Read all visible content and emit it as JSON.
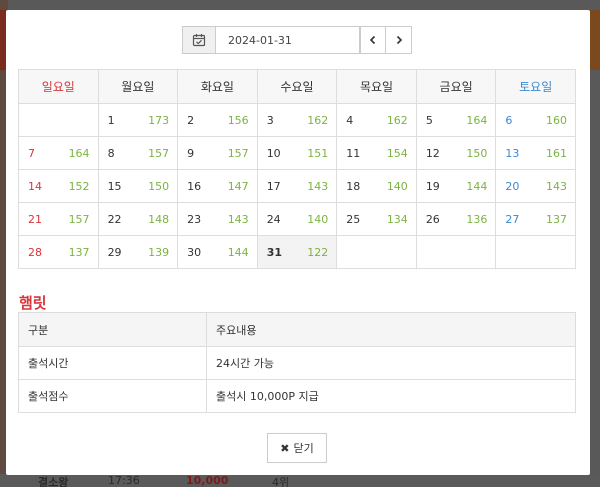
{
  "datebar": {
    "date_value": "2024-01-31",
    "prev_label": "‹",
    "next_label": "›"
  },
  "calendar": {
    "weekdays": [
      "일요일",
      "월요일",
      "화요일",
      "수요일",
      "목요일",
      "금요일",
      "토요일"
    ],
    "weeks": [
      [
        null,
        {
          "d": "1",
          "c": "173"
        },
        {
          "d": "2",
          "c": "156"
        },
        {
          "d": "3",
          "c": "162"
        },
        {
          "d": "4",
          "c": "162"
        },
        {
          "d": "5",
          "c": "164"
        },
        {
          "d": "6",
          "c": "160"
        }
      ],
      [
        {
          "d": "7",
          "c": "164"
        },
        {
          "d": "8",
          "c": "157"
        },
        {
          "d": "9",
          "c": "157"
        },
        {
          "d": "10",
          "c": "151"
        },
        {
          "d": "11",
          "c": "154"
        },
        {
          "d": "12",
          "c": "150"
        },
        {
          "d": "13",
          "c": "161"
        }
      ],
      [
        {
          "d": "14",
          "c": "152"
        },
        {
          "d": "15",
          "c": "150"
        },
        {
          "d": "16",
          "c": "147"
        },
        {
          "d": "17",
          "c": "143"
        },
        {
          "d": "18",
          "c": "140"
        },
        {
          "d": "19",
          "c": "144"
        },
        {
          "d": "20",
          "c": "143"
        }
      ],
      [
        {
          "d": "21",
          "c": "157"
        },
        {
          "d": "22",
          "c": "148"
        },
        {
          "d": "23",
          "c": "143"
        },
        {
          "d": "24",
          "c": "140"
        },
        {
          "d": "25",
          "c": "134"
        },
        {
          "d": "26",
          "c": "136"
        },
        {
          "d": "27",
          "c": "137"
        }
      ],
      [
        {
          "d": "28",
          "c": "137"
        },
        {
          "d": "29",
          "c": "139"
        },
        {
          "d": "30",
          "c": "144"
        },
        {
          "d": "31",
          "c": "122",
          "today": true
        },
        null,
        null,
        null
      ]
    ]
  },
  "section": {
    "title": "햄릿"
  },
  "info": {
    "col1": "구분",
    "col2": "주요내용",
    "rows": [
      {
        "label": "출석시간",
        "value": "24시간 가능"
      },
      {
        "label": "출석점수",
        "value": "출석시 10,000P 지급"
      }
    ]
  },
  "close_label": "닫기",
  "background": {
    "name": "결소왕",
    "time": "17:36",
    "points": "10,000",
    "count": "4위"
  },
  "colors": {
    "sunday": "#d9343a",
    "saturday": "#3a8ad4",
    "count_green": "#7cb342"
  }
}
